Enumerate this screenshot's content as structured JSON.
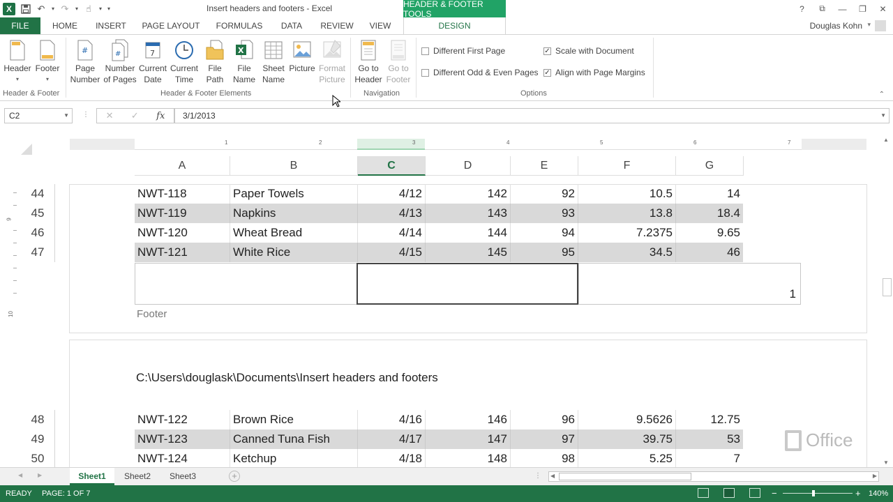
{
  "window": {
    "title": "Insert headers and footers - Excel",
    "context_tab_title": "HEADER & FOOTER TOOLS",
    "controls": [
      "?",
      "⧉",
      "—",
      "❐",
      "✕"
    ]
  },
  "ribbon_tabs": [
    {
      "label": "FILE"
    },
    {
      "label": "HOME"
    },
    {
      "label": "INSERT"
    },
    {
      "label": "PAGE LAYOUT"
    },
    {
      "label": "FORMULAS"
    },
    {
      "label": "DATA"
    },
    {
      "label": "REVIEW"
    },
    {
      "label": "VIEW"
    },
    {
      "label": "DESIGN"
    }
  ],
  "user_name": "Douglas Kohn",
  "ribbon": {
    "header_footer_group": {
      "label": "Header & Footer",
      "buttons": [
        {
          "line1": "Header",
          "line2": ""
        },
        {
          "line1": "Footer",
          "line2": ""
        }
      ]
    },
    "elements_group": {
      "label": "Header & Footer Elements",
      "buttons": [
        {
          "line1": "Page",
          "line2": "Number"
        },
        {
          "line1": "Number",
          "line2": "of Pages"
        },
        {
          "line1": "Current",
          "line2": "Date"
        },
        {
          "line1": "Current",
          "line2": "Time"
        },
        {
          "line1": "File",
          "line2": "Path"
        },
        {
          "line1": "File",
          "line2": "Name"
        },
        {
          "line1": "Sheet",
          "line2": "Name"
        },
        {
          "line1": "Picture",
          "line2": ""
        },
        {
          "line1": "Format",
          "line2": "Picture"
        }
      ]
    },
    "navigation_group": {
      "label": "Navigation",
      "buttons": [
        {
          "line1": "Go to",
          "line2": "Header"
        },
        {
          "line1": "Go to",
          "line2": "Footer"
        }
      ]
    },
    "options_group": {
      "label": "Options",
      "checkboxes": [
        {
          "label": "Different First Page",
          "checked": false
        },
        {
          "label": "Different Odd & Even Pages",
          "checked": false
        },
        {
          "label": "Scale with Document",
          "checked": true
        },
        {
          "label": "Align with Page Margins",
          "checked": true
        }
      ]
    }
  },
  "formula_bar": {
    "name_box": "C2",
    "fx": "fx",
    "value": "3/1/2013"
  },
  "ruler_numbers": [
    "1",
    "2",
    "3",
    "4",
    "5",
    "6",
    "7"
  ],
  "vruler_numbers": [
    "9",
    "10"
  ],
  "columns": [
    "A",
    "B",
    "C",
    "D",
    "E",
    "F",
    "G"
  ],
  "rows_page1": [
    {
      "num": "44",
      "cells": [
        "NWT-118",
        "Paper Towels",
        "4/12",
        "142",
        "92",
        "10.5",
        "14"
      ]
    },
    {
      "num": "45",
      "cells": [
        "NWT-119",
        "Napkins",
        "4/13",
        "143",
        "93",
        "13.8",
        "18.4"
      ]
    },
    {
      "num": "46",
      "cells": [
        "NWT-120",
        "Wheat Bread",
        "4/14",
        "144",
        "94",
        "7.2375",
        "9.65"
      ]
    },
    {
      "num": "47",
      "cells": [
        "NWT-121",
        "White Rice",
        "4/15",
        "145",
        "95",
        "34.5",
        "46"
      ]
    }
  ],
  "footer": {
    "label": "Footer",
    "page_number": "1"
  },
  "page2_header_path": "C:\\Users\\douglask\\Documents\\Insert headers and footers",
  "rows_page2": [
    {
      "num": "48",
      "cells": [
        "NWT-122",
        "Brown Rice",
        "4/16",
        "146",
        "96",
        "9.5626",
        "12.75"
      ]
    },
    {
      "num": "49",
      "cells": [
        "NWT-123",
        "Canned Tuna Fish",
        "4/17",
        "147",
        "97",
        "39.75",
        "53"
      ]
    },
    {
      "num": "50",
      "cells": [
        "NWT-124",
        "Ketchup",
        "4/18",
        "148",
        "98",
        "5.25",
        "7"
      ]
    }
  ],
  "watermark": "Office",
  "sheet_tabs": [
    {
      "label": "Sheet1",
      "active": true
    },
    {
      "label": "Sheet2",
      "active": false
    },
    {
      "label": "Sheet3",
      "active": false
    }
  ],
  "status": {
    "ready": "READY",
    "page": "PAGE: 1 OF 7",
    "zoom": "140%"
  },
  "colors": {
    "excel_green": "#217346",
    "context_green": "#21a366"
  }
}
